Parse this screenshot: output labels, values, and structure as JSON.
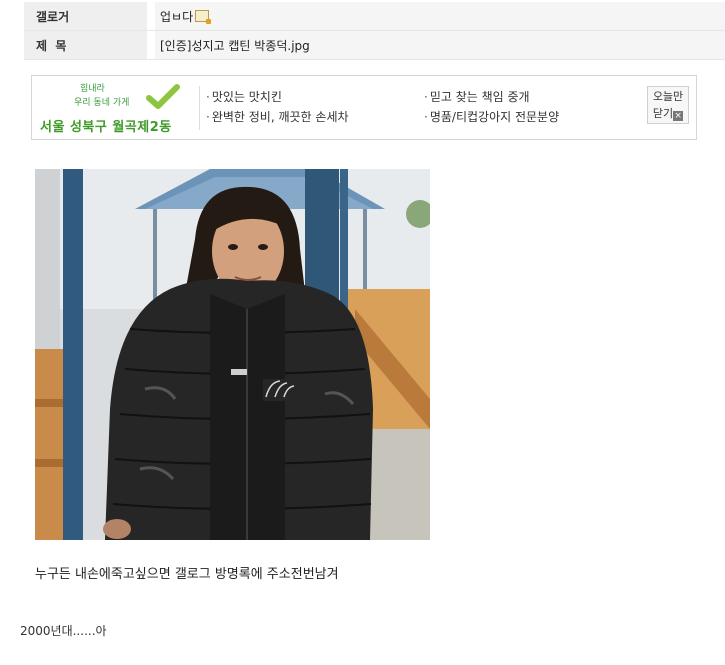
{
  "post_meta": {
    "gallery_label": "갤로거",
    "gallery_value": "업ㅂ다",
    "title_label": "제  목",
    "title_value": "[인증]성지고 캡틴 박종덕.jpg"
  },
  "ad": {
    "logo_small_line1": "힘내라",
    "logo_small_line2": "우리 동네 가게",
    "logo_title": "서울 성북구 월곡제2동",
    "links": [
      "맛있는 맛치킨",
      "믿고 찾는 책임 중개",
      "완벽한 정비, 깨끗한 손세차",
      "명품/티컵강아지 전문분양"
    ],
    "close_line1": "오늘만",
    "close_line2": "닫기",
    "close_icon": "close-icon"
  },
  "caption": "누구든 내손에죽고싶으면 갤로그 방명록에 주소전번남겨",
  "footer": "2000년대......아",
  "colors": {
    "label_bg": "#efefef",
    "value_bg": "#f5f5f5",
    "ad_green": "#3f9a28"
  }
}
